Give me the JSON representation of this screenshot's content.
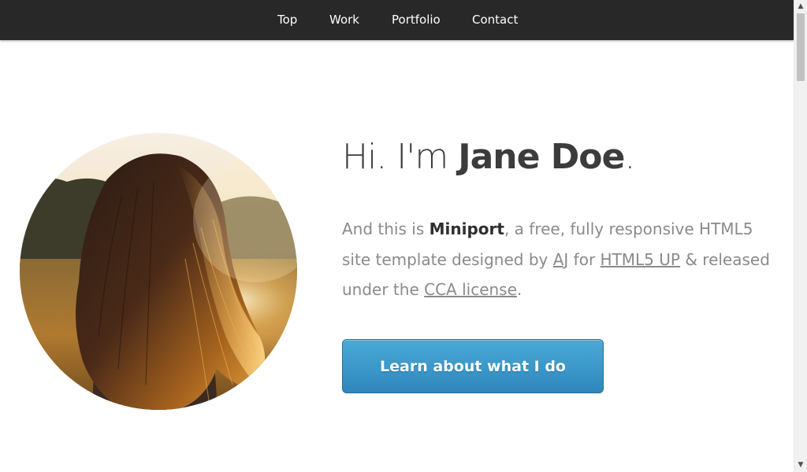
{
  "nav": {
    "items": [
      {
        "label": "Top"
      },
      {
        "label": "Work"
      },
      {
        "label": "Portfolio"
      },
      {
        "label": "Contact"
      }
    ]
  },
  "hero": {
    "greeting_prefix": "Hi. I'm ",
    "name": "Jane Doe",
    "greeting_suffix": ".",
    "intro": {
      "line1_prefix": "And this is ",
      "product": "Miniport",
      "line1_suffix": ", a free, fully responsive HTML5",
      "line2_prefix": "site template designed by ",
      "author_link": "AJ",
      "line2_middle": " for ",
      "site_link": "HTML5 UP",
      "line2_suffix": " & released",
      "line3_prefix": "under the ",
      "license_link": "CCA license",
      "line3_suffix": "."
    },
    "cta_label": "Learn about what I do",
    "portrait_icon": "portrait-photo"
  },
  "colors": {
    "nav_bg": "#282828",
    "nav_text": "#ffffff",
    "headline": "#3c3c3c",
    "body_text": "#8a8a8a",
    "button_blue": "#3a97c9"
  },
  "scrollbar": {
    "up_icon": "arrow-up-icon",
    "down_icon": "arrow-down-icon"
  }
}
